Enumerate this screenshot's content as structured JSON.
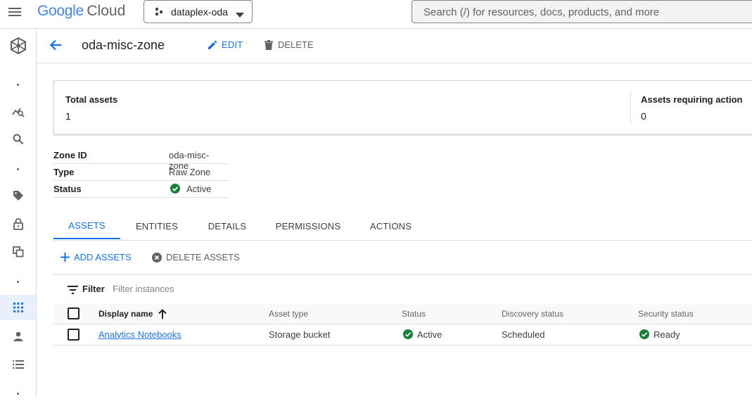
{
  "topbar": {
    "logo_google": "Google",
    "logo_cloud": "Cloud",
    "project": "dataplex-oda",
    "search_placeholder": "Search (/) for resources, docs, products, and more"
  },
  "header": {
    "title": "oda-misc-zone",
    "edit_label": "EDIT",
    "delete_label": "DELETE"
  },
  "stats": {
    "total_label": "Total assets",
    "total_value": "1",
    "action_label": "Assets requiring action",
    "action_value": "0"
  },
  "info": [
    {
      "key": "Zone ID",
      "value": "oda-misc-zone"
    },
    {
      "key": "Type",
      "value": "Raw Zone"
    },
    {
      "key": "Status",
      "value": "Active"
    }
  ],
  "tabs": [
    "ASSETS",
    "ENTITIES",
    "DETAILS",
    "PERMISSIONS",
    "ACTIONS"
  ],
  "actions": {
    "add_label": "ADD ASSETS",
    "delete_label": "DELETE ASSETS"
  },
  "filter": {
    "label": "Filter",
    "placeholder": "Filter instances"
  },
  "table": {
    "columns": [
      "Display name",
      "Asset type",
      "Status",
      "Discovery status",
      "Security status"
    ],
    "rows": [
      {
        "name": "Analytics Notebooks",
        "type": "Storage bucket",
        "status": "Active",
        "discovery": "Scheduled",
        "security": "Ready"
      }
    ]
  },
  "colors": {
    "accent": "#1a73e8",
    "success": "#188038"
  }
}
